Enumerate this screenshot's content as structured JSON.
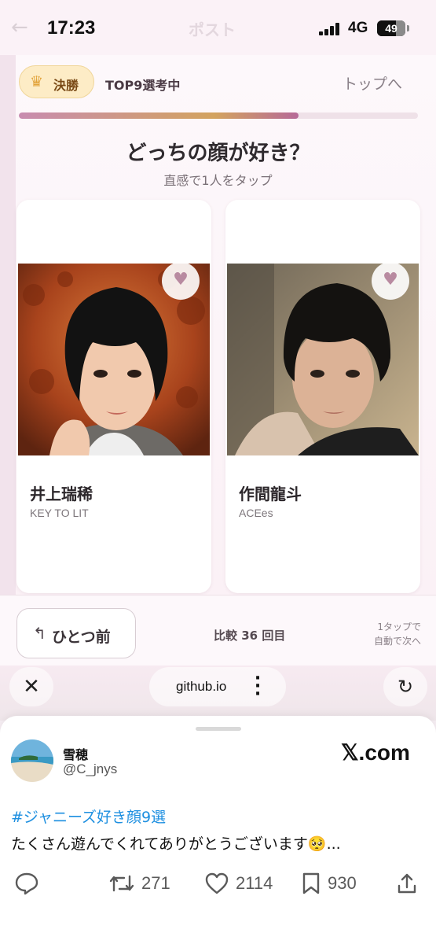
{
  "status_bar": {
    "time": "17:23",
    "network": "4G",
    "battery": "49",
    "battery_level": 0.49
  },
  "header_ghost": {
    "title": "ポスト"
  },
  "round": {
    "badge_label": "決勝",
    "status": "TOP9選考中",
    "top_link": "トップへ",
    "progress": 0.7
  },
  "question": {
    "title": "どっちの顔が好き？",
    "hint": "直感で1人をタップ"
  },
  "candidates": [
    {
      "name": "井上瑞稀",
      "group": "KEY TO LIT"
    },
    {
      "name": "作間龍斗",
      "group": "ACEes"
    }
  ],
  "controls": {
    "prev_label": "ひとつ前",
    "compare": "比較 36 回目",
    "auto_note_1": "1タップで",
    "auto_note_2": "自動で次へ"
  },
  "browser": {
    "url": "github.io"
  },
  "tweet": {
    "user_name": "雪穂",
    "user_handle": "@C_jnys",
    "brand": "𝕏.com",
    "hashtag": "#ジャニーズ好き顔9選",
    "text": "たくさん遊んでくれてありがとうございます🥺...",
    "retweets": "271",
    "likes": "2114",
    "bookmarks": "930"
  },
  "icons": [
    "back-arrow-icon",
    "crown-icon",
    "heart-icon",
    "undo-arrow-icon",
    "close-icon",
    "more-icon",
    "reload-icon",
    "reply-icon",
    "retweet-icon",
    "like-icon",
    "bookmark-icon",
    "share-icon"
  ],
  "colors": {
    "accent_pink": "#c88cb0",
    "badge_bg": "#fdecc6",
    "link_blue": "#1d8fe0"
  }
}
